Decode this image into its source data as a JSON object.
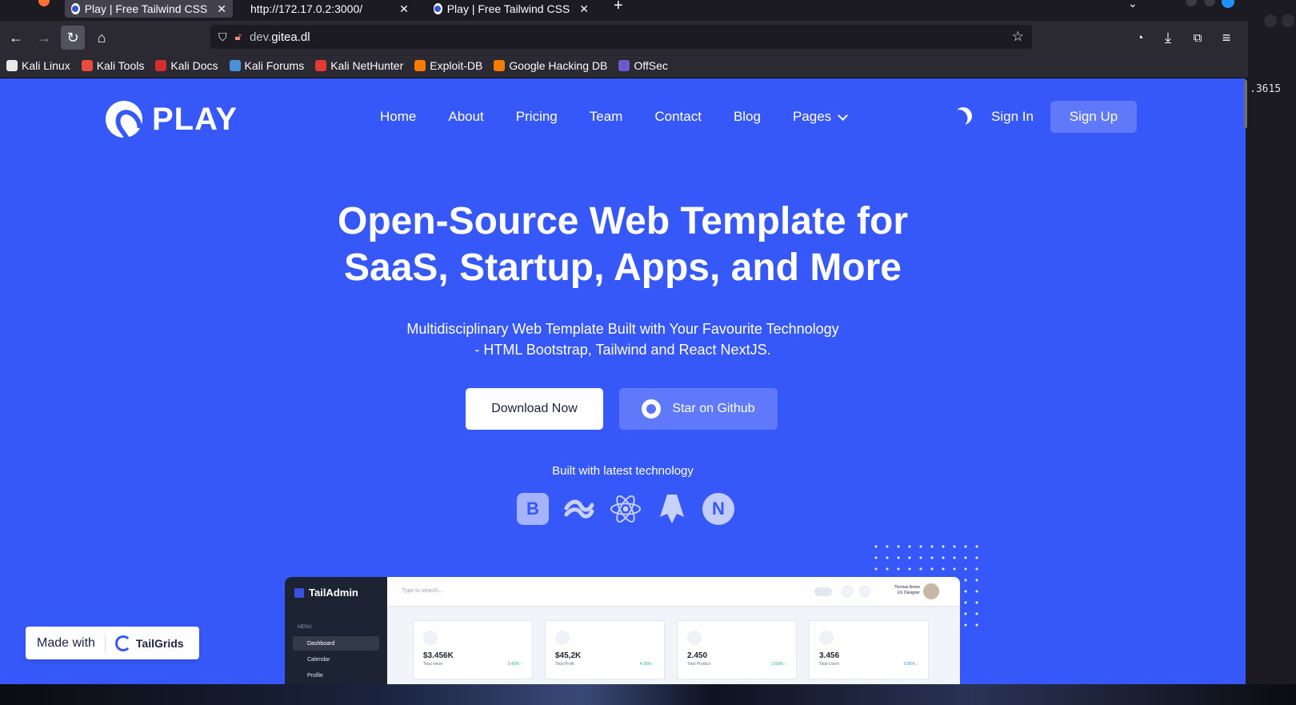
{
  "browser": {
    "tabs": [
      {
        "label": "Play | Free Tailwind CSS"
      },
      {
        "label": "http://172.17.0.2:3000/"
      },
      {
        "label": "Play | Free Tailwind CSS"
      }
    ],
    "url_host": "dev.",
    "url_domain": "gitea.dl",
    "bookmarks": [
      {
        "label": "Kali Linux",
        "icon": "kali-icon",
        "color": "#e9e9e9"
      },
      {
        "label": "Kali Tools",
        "icon": "kali-tools-icon",
        "color": "#e74c3c"
      },
      {
        "label": "Kali Docs",
        "icon": "kali-docs-icon",
        "color": "#d32f2f"
      },
      {
        "label": "Kali Forums",
        "icon": "kali-forums-icon",
        "color": "#4a90d9"
      },
      {
        "label": "Kali NetHunter",
        "icon": "nethunter-icon",
        "color": "#e53935"
      },
      {
        "label": "Exploit-DB",
        "icon": "exploit-db-icon",
        "color": "#f57c00"
      },
      {
        "label": "Google Hacking DB",
        "icon": "ghdb-icon",
        "color": "#f57c00"
      },
      {
        "label": "OffSec",
        "icon": "offsec-icon",
        "color": "#6a5acd"
      }
    ],
    "side_readout": ".3615"
  },
  "site": {
    "logo_text": "PLAY",
    "nav": [
      "Home",
      "About",
      "Pricing",
      "Team",
      "Contact",
      "Blog",
      "Pages"
    ],
    "signin": "Sign In",
    "signup": "Sign Up",
    "hero_line1": "Open-Source Web Template for",
    "hero_line2": "SaaS, Startup, Apps, and More",
    "sub_line1": "Multidisciplinary Web Template Built with Your Favourite Technology",
    "sub_line2": "- HTML Bootstrap, Tailwind and React NextJS.",
    "download": "Download Now",
    "github": "Star on Github",
    "built_with": "Built with latest technology",
    "tech_b": "B",
    "tech_n": "N",
    "colors": {
      "primary": "#3758f9",
      "dark": "#1d2144"
    }
  },
  "dashboard": {
    "brand": "TailAdmin",
    "menu_label": "MENU",
    "menu_dashboard": "Dashboard",
    "menu_calendar": "Calendar",
    "menu_profile": "Profile",
    "search_placeholder": "Type to search...",
    "user_name": "Thomas Anree",
    "user_role": "UX Designer",
    "cards": [
      {
        "value": "$3.456K",
        "label": "Total views",
        "pct": "0.43% ↑"
      },
      {
        "value": "$45,2K",
        "label": "Total Profit",
        "pct": "4.35% ↑"
      },
      {
        "value": "2.450",
        "label": "Total Product",
        "pct": "2.59% ↑"
      },
      {
        "value": "3.456",
        "label": "Total Users",
        "pct": "0.95% ↓"
      }
    ]
  },
  "badge": {
    "made_with": "Made with",
    "brand": "TailGrids"
  }
}
